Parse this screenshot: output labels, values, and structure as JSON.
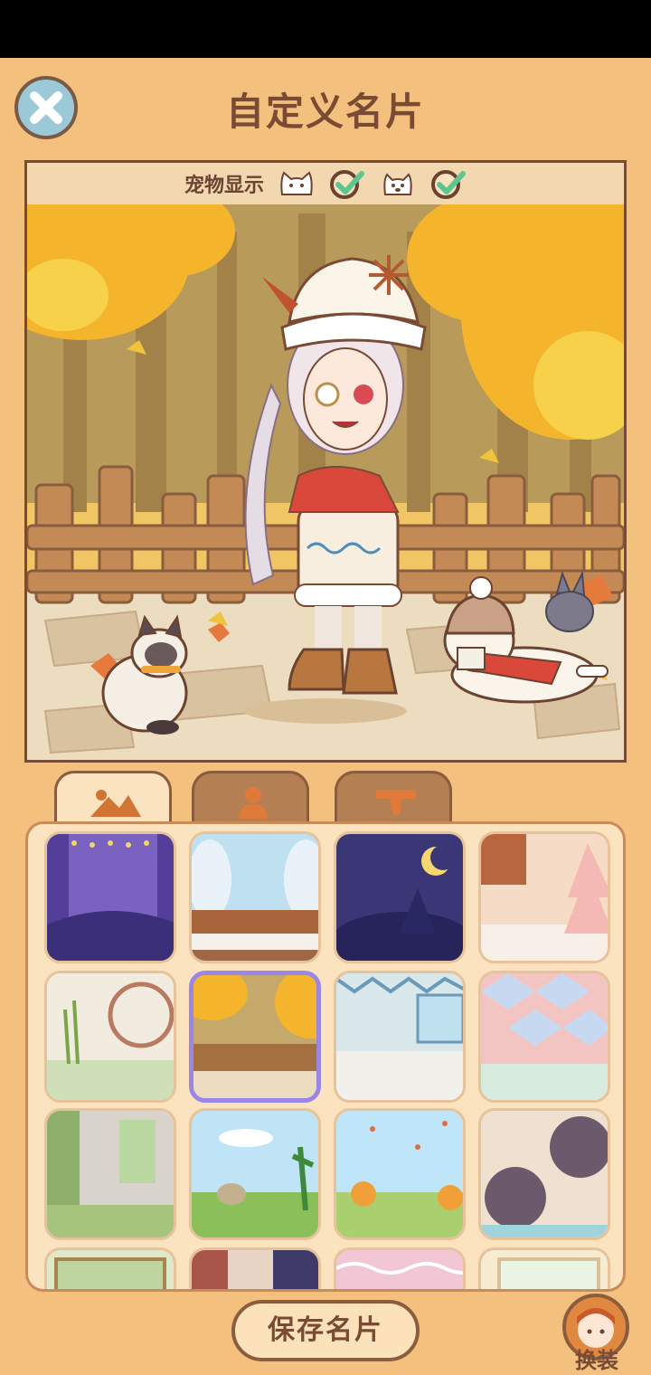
{
  "title": "自定义名片",
  "pet_display": {
    "label": "宠物显示",
    "cat_enabled": true,
    "dog_enabled": true
  },
  "tabs": [
    {
      "name": "background-tab",
      "icon": "landscape-icon",
      "active": true
    },
    {
      "name": "character-tab",
      "icon": "person-icon",
      "active": false
    },
    {
      "name": "frame-tab",
      "icon": "badge-icon",
      "active": false
    }
  ],
  "backgrounds": [
    {
      "theme": "purple-stage",
      "selected": false
    },
    {
      "theme": "snowy-forest",
      "selected": false
    },
    {
      "theme": "night-sky",
      "selected": false
    },
    {
      "theme": "pink-cottage",
      "selected": false
    },
    {
      "theme": "bamboo-room",
      "selected": false
    },
    {
      "theme": "autumn-fence",
      "selected": true
    },
    {
      "theme": "bunting-room",
      "selected": false
    },
    {
      "theme": "pastel-diamonds",
      "selected": false
    },
    {
      "theme": "garden-wall",
      "selected": false
    },
    {
      "theme": "corn-field",
      "selected": false
    },
    {
      "theme": "autumn-meadow",
      "selected": false
    },
    {
      "theme": "polka-circles",
      "selected": false
    },
    {
      "theme": "green-window",
      "selected": false
    },
    {
      "theme": "dark-room",
      "selected": false
    },
    {
      "theme": "pink-lace",
      "selected": false
    },
    {
      "theme": "bright-window",
      "selected": false
    }
  ],
  "save_button_label": "保存名片",
  "outfit_button_label": "换装",
  "colors": {
    "background": "#f3c07e",
    "text_brown": "#7a4b34",
    "selected_border": "#9a86e6",
    "check_green": "#5cc890"
  }
}
